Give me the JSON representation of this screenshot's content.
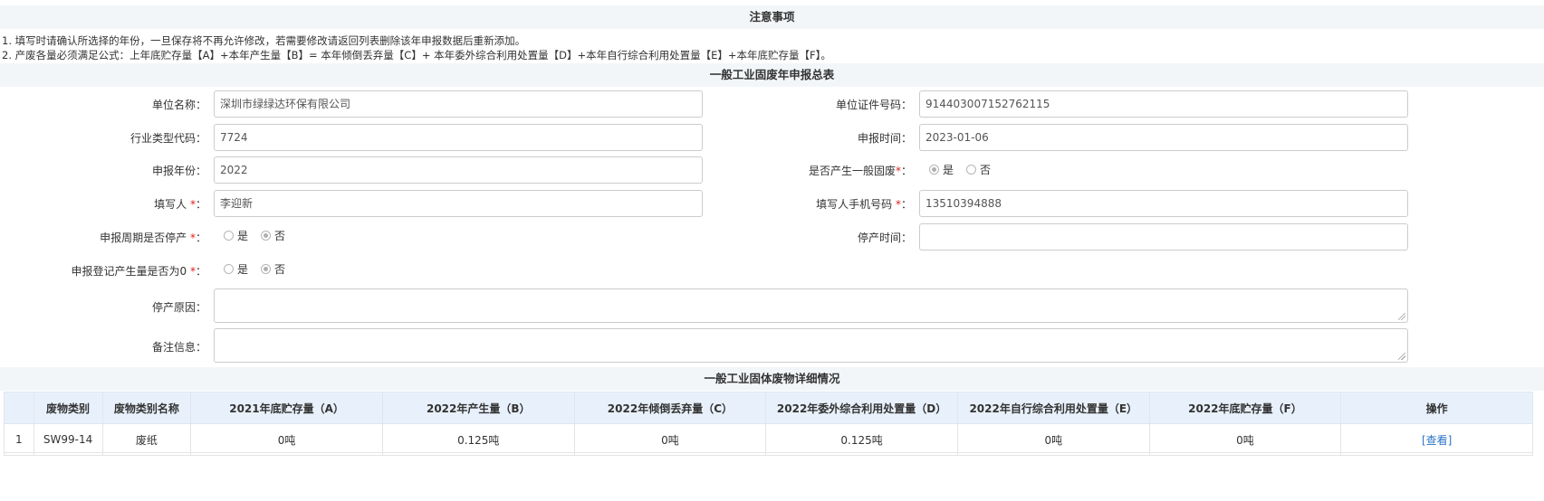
{
  "notice": {
    "title": "注意事项",
    "lines": [
      "1. 填写时请确认所选择的年份，一旦保存将不再允许修改，若需要修改请返回列表删除该年申报数据后重新添加。",
      "2. 产废各量必须满足公式：上年底贮存量【A】+本年产生量【B】= 本年倾倒丢弃量【C】+ 本年委外综合利用处置量【D】+本年自行综合利用处置量【E】+本年底贮存量【F】。"
    ]
  },
  "summary": {
    "title": "一般工业固废年申报总表",
    "unit_name_label": "单位名称：",
    "unit_name_value": "深圳市绿绿达环保有限公司",
    "cert_no_label": "单位证件号码：",
    "cert_no_value": "914403007152762115",
    "industry_code_label": "行业类型代码：",
    "industry_code_value": "7724",
    "declare_time_label": "申报时间：",
    "declare_time_value": "2023-01-06",
    "declare_year_label": "申报年份：",
    "declare_year_value": "2022",
    "produce_waste_label": "是否产生一般固废",
    "filler_label": "填写人",
    "filler_value": "李迎新",
    "filler_phone_label": "填写人手机号码",
    "filler_phone_value": "13510394888",
    "stopped_label": "申报周期是否停产",
    "stop_time_label": "停产时间：",
    "stop_time_value": "",
    "zero_output_label": "申报登记产生量是否为0",
    "stop_reason_label": "停产原因：",
    "remark_label": "备注信息：",
    "required_mark": "*",
    "colon": "：",
    "yes": "是",
    "no": "否"
  },
  "detail": {
    "title": "一般工业固体废物详细情况",
    "columns": [
      "",
      "废物类别",
      "废物类别名称",
      "2021年底贮存量（A）",
      "2022年产生量（B）",
      "2022年倾倒丢弃量（C）",
      "2022年委外综合利用处置量（D）",
      "2022年自行综合利用处置量（E）",
      "2022年底贮存量（F）",
      "操作"
    ],
    "rows": [
      [
        "1",
        "SW99-14",
        "废纸",
        "0吨",
        "0.125吨",
        "0吨",
        "0.125吨",
        "0吨",
        "0吨",
        "[查看]"
      ]
    ]
  }
}
